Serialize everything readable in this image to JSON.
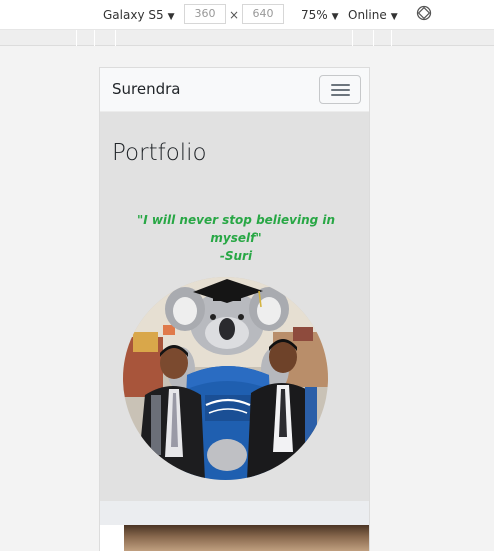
{
  "devtools": {
    "device": "Galaxy S5",
    "width": "360",
    "height": "640",
    "times": "×",
    "zoom": "75%",
    "network": "Online",
    "caret": "▼",
    "icons": {
      "rotate": "rotate-icon",
      "dropdown": "caret-down-icon"
    }
  },
  "site": {
    "brand": "Surendra",
    "title": "Portfolio",
    "quote_line": "\"I will never stop believing in myself\"",
    "quote_author": "-Suri",
    "colors": {
      "quote": "#28a745",
      "navbar": "#f8f9fa",
      "jumbotron": "#e1e1e1"
    }
  }
}
